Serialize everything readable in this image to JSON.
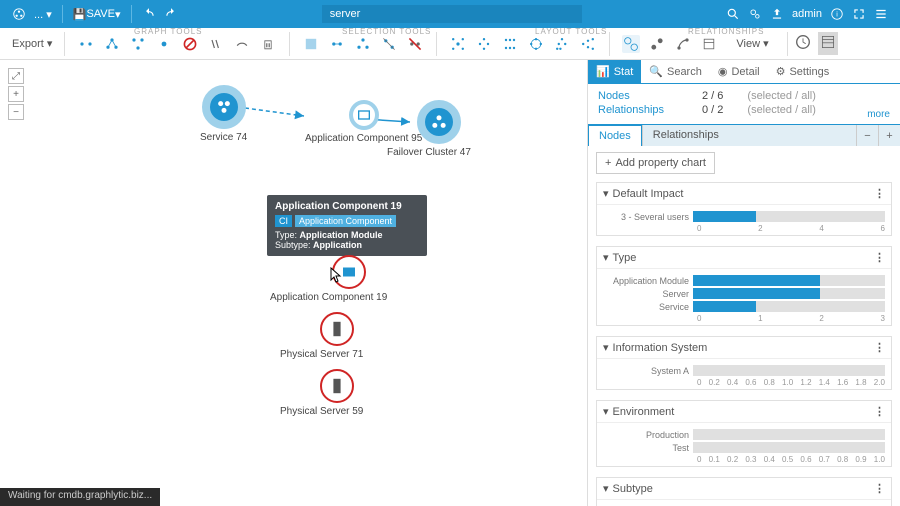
{
  "topbar": {
    "save": "SAVE",
    "search_value": "server",
    "user": "admin"
  },
  "subbar": {
    "export": "Export",
    "view": "View",
    "groups": {
      "graph": "GRAPH TOOLS",
      "selection": "SELECTION TOOLS",
      "layout": "LAYOUT TOOLS",
      "rel": "RELATIONSHIPS"
    }
  },
  "canvas": {
    "nodes": [
      {
        "id": "service74",
        "label": "Service 74"
      },
      {
        "id": "appcomp95",
        "label": "Application Component 95"
      },
      {
        "id": "failover47",
        "label": "Failover Cluster 47"
      },
      {
        "id": "appcomp19",
        "label": "Application Component 19"
      },
      {
        "id": "phys71",
        "label": "Physical Server 71"
      },
      {
        "id": "phys59",
        "label": "Physical Server 59"
      }
    ],
    "tooltip": {
      "title": "Application Component 19",
      "badge1": "CI",
      "badge2": "Application Component",
      "l1_k": "Type:",
      "l1_v": "Application Module",
      "l2_k": "Subtype:",
      "l2_v": "Application"
    }
  },
  "sidepanel": {
    "tabs": {
      "stat": "Stat",
      "search": "Search",
      "detail": "Detail",
      "settings": "Settings"
    },
    "sel": {
      "nodes_lbl": "Nodes",
      "nodes_val": "2 / 6",
      "rel_lbl": "Relationships",
      "rel_val": "0 / 2",
      "sub": "(selected / all)",
      "more": "more"
    },
    "subtabs": {
      "nodes": "Nodes",
      "rel": "Relationships"
    },
    "add_chart": "Add property chart",
    "charts": [
      {
        "title": "Default Impact",
        "rows": [
          {
            "label": "3 - Several users",
            "pct": 33
          }
        ],
        "ticks": [
          "0",
          "2",
          "4",
          "6"
        ]
      },
      {
        "title": "Type",
        "rows": [
          {
            "label": "Application Module",
            "pct": 66
          },
          {
            "label": "Server",
            "pct": 66
          },
          {
            "label": "Service",
            "pct": 33
          }
        ],
        "ticks": [
          "0",
          "1",
          "2",
          "3"
        ]
      },
      {
        "title": "Information System",
        "rows": [
          {
            "label": "System A",
            "pct": 0
          }
        ],
        "ticks": [
          "0",
          "0.2",
          "0.4",
          "0.6",
          "0.8",
          "1.0",
          "1.2",
          "1.4",
          "1.6",
          "1.8",
          "2.0"
        ]
      },
      {
        "title": "Environment",
        "rows": [
          {
            "label": "Production",
            "pct": 0
          },
          {
            "label": "Test",
            "pct": 0
          }
        ],
        "ticks": [
          "0",
          "0.1",
          "0.2",
          "0.3",
          "0.4",
          "0.5",
          "0.6",
          "0.7",
          "0.8",
          "0.9",
          "1.0"
        ]
      },
      {
        "title": "Subtype",
        "rows": [],
        "ticks": []
      }
    ]
  },
  "status": "Waiting for cmdb.graphlytic.biz...",
  "chart_data": [
    {
      "type": "bar",
      "title": "Default Impact",
      "categories": [
        "3 - Several users"
      ],
      "values": [
        2
      ],
      "xlim": [
        0,
        6
      ]
    },
    {
      "type": "bar",
      "title": "Type",
      "categories": [
        "Application Module",
        "Server",
        "Service"
      ],
      "values": [
        2,
        2,
        1
      ],
      "xlim": [
        0,
        3
      ]
    },
    {
      "type": "bar",
      "title": "Information System",
      "categories": [
        "System A"
      ],
      "values": [
        0
      ],
      "xlim": [
        0,
        2.0
      ]
    },
    {
      "type": "bar",
      "title": "Environment",
      "categories": [
        "Production",
        "Test"
      ],
      "values": [
        0,
        0
      ],
      "xlim": [
        0,
        1.0
      ]
    }
  ]
}
